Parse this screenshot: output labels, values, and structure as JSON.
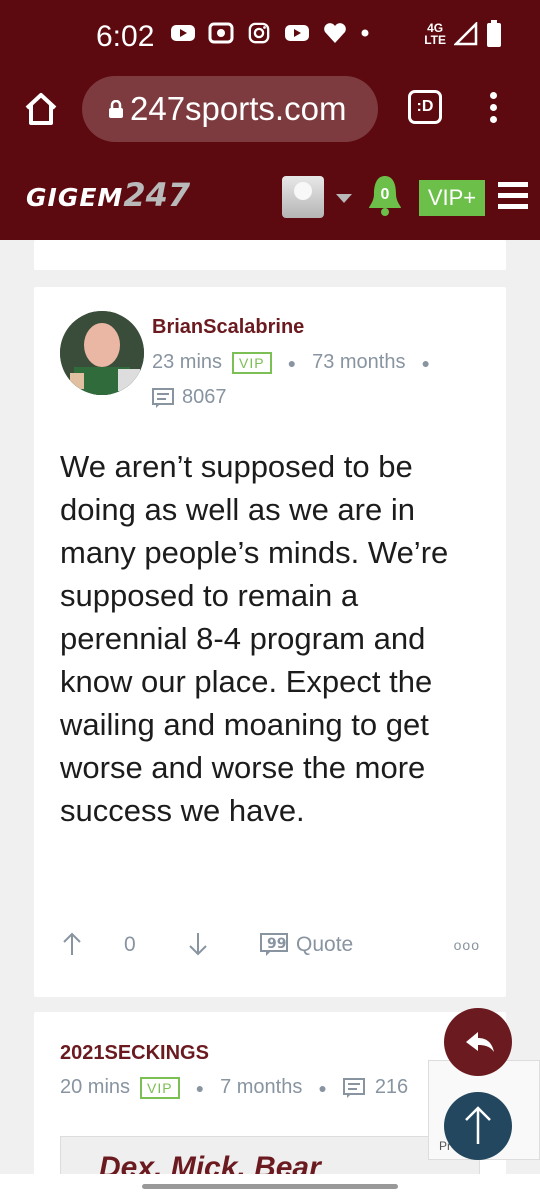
{
  "status_bar": {
    "time": "6:02",
    "network": "4G LTE",
    "icons": [
      "youtube-icon",
      "radio-icon",
      "instagram-icon",
      "youtube-icon",
      "heart-icon",
      "dot-icon",
      "signal-icon",
      "battery-icon"
    ]
  },
  "browser": {
    "url": "247sports.com",
    "url_prefix": "",
    "tab_label": ":D"
  },
  "site_header": {
    "logo_text": "GIGEM",
    "logo_number": "247",
    "notification_count": "0",
    "vip_label": "VIP+",
    "brand_color": "#5c0a0f",
    "vip_color": "#6cc04a"
  },
  "post": {
    "username": "BrianScalabrine",
    "time_ago": "23 mins",
    "badge": "VIP",
    "membership": "73 months",
    "message_count": "8067",
    "body": "We aren’t supposed to be doing as well as we are in many people’s minds. We’re supposed to remain a perennial 8-4 program and know our place. Expect the wailing and moaning to get worse and worse the more success we have.",
    "upvotes": "0",
    "quote_label": "Quote",
    "more_label": "ooo"
  },
  "next_post": {
    "username": "2021SECKINGS",
    "time_ago": "20 mins",
    "badge": "VIP",
    "membership": "7 months",
    "message_count": "216",
    "quote_preview": "Dex, Mick, Bear"
  },
  "recaptcha": {
    "text": "Privacy - Terms",
    "text_visible": "Pr         erms"
  }
}
